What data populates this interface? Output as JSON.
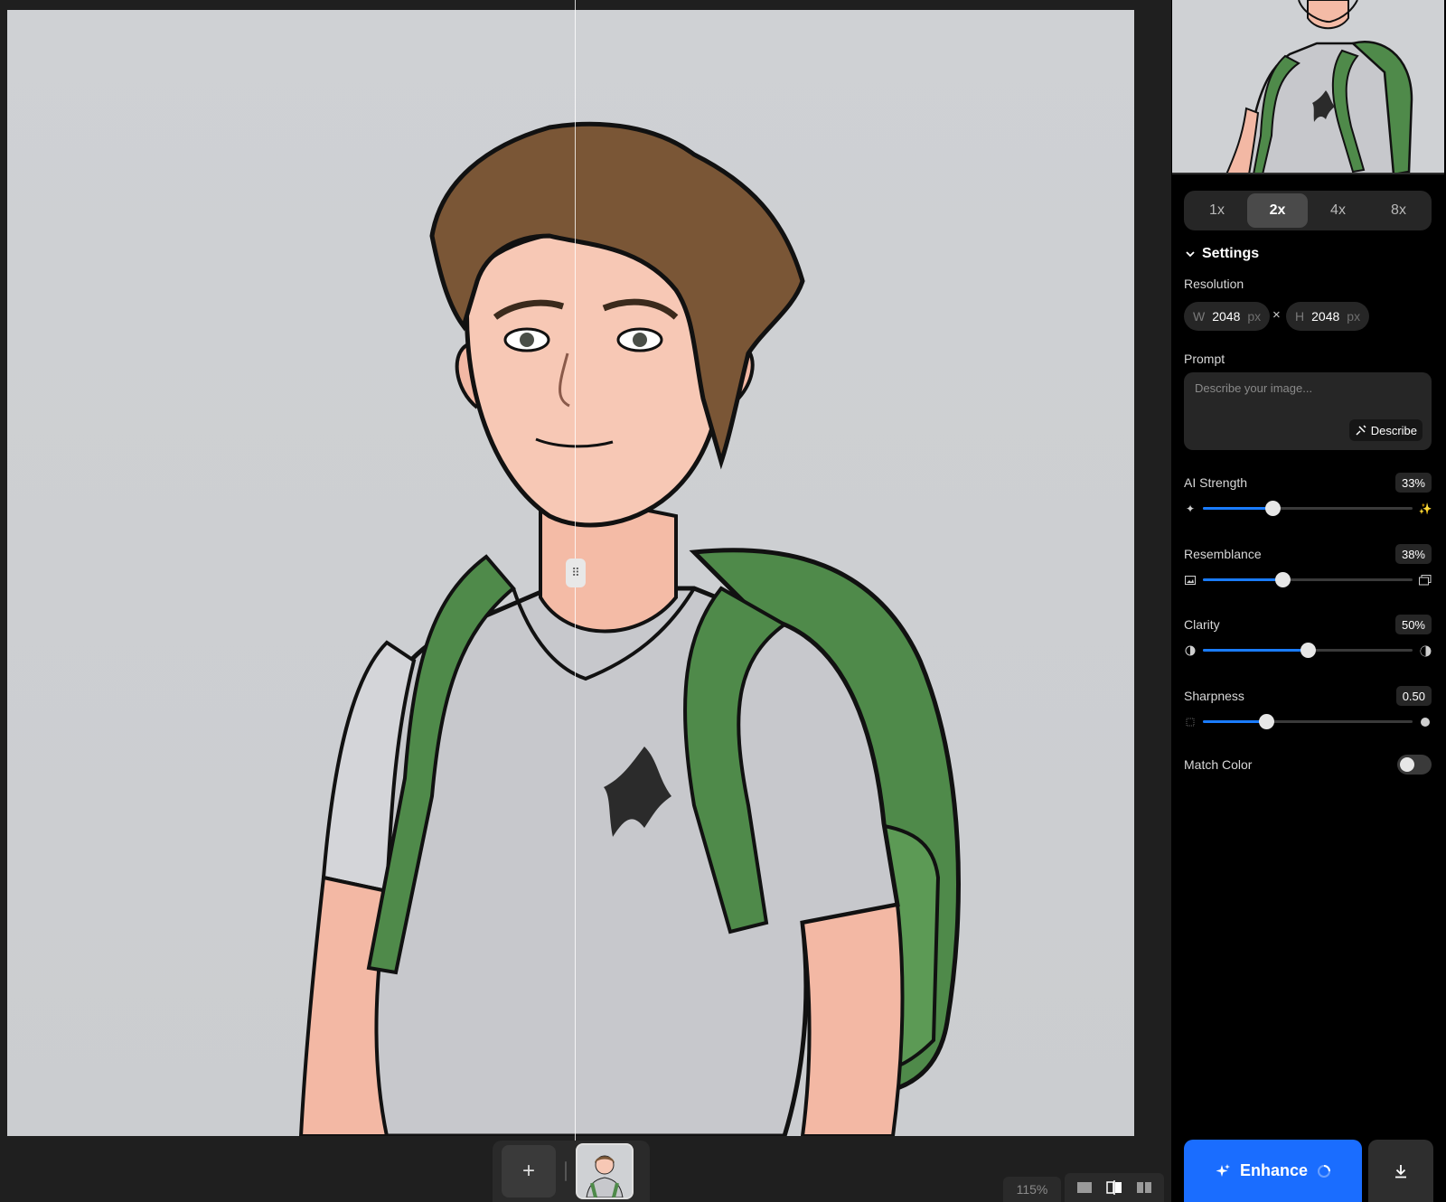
{
  "canvas": {
    "zoom": "115%",
    "handle_glyph": "⠿",
    "add_glyph": "+"
  },
  "scale": {
    "options": [
      "1x",
      "2x",
      "4x",
      "8x"
    ],
    "selected": "2x"
  },
  "settings": {
    "title": "Settings",
    "resolution": {
      "label": "Resolution",
      "w_prefix": "W",
      "w_value": "2048",
      "h_prefix": "H",
      "h_value": "2048",
      "unit": "px",
      "separator": "×"
    },
    "prompt": {
      "label": "Prompt",
      "placeholder": "Describe your image...",
      "value": "",
      "describe_label": "Describe"
    },
    "sliders": {
      "ai_strength": {
        "label": "AI Strength",
        "display": "33%",
        "value": 0.33
      },
      "resemblance": {
        "label": "Resemblance",
        "display": "38%",
        "value": 0.38
      },
      "clarity": {
        "label": "Clarity",
        "display": "50%",
        "value": 0.5
      },
      "sharpness": {
        "label": "Sharpness",
        "display": "0.50",
        "value": 0.3
      }
    },
    "match_color": {
      "label": "Match Color",
      "enabled": false
    }
  },
  "actions": {
    "enhance_label": "Enhance"
  },
  "colors": {
    "accent": "#1a6dff",
    "slider_fill": "#1a7cff",
    "panel_bg": "#000000",
    "canvas_bg": "#1f1f1f"
  },
  "icons": {
    "settings_chevron": "chevron-down-icon",
    "describe": "describe-icon",
    "enhance": "sparkle-icon",
    "download": "download-icon",
    "add": "plus-icon"
  }
}
